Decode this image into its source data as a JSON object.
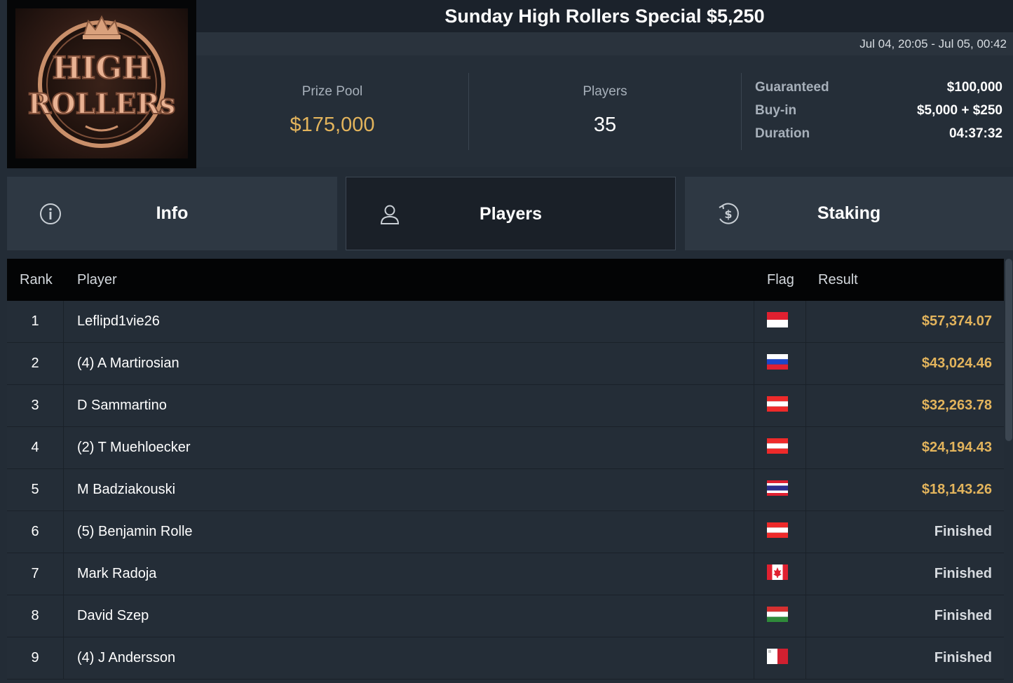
{
  "tournament": {
    "title": "Sunday High Rollers Special $5,250",
    "date_range": "Jul 04, 20:05 - Jul 05, 00:42",
    "logo_text": "HIGH ROLLERS"
  },
  "stats": {
    "prize_pool_label": "Prize Pool",
    "prize_pool_value": "$175,000",
    "players_label": "Players",
    "players_value": "35",
    "details": [
      {
        "label": "Guaranteed",
        "value": "$100,000"
      },
      {
        "label": "Buy-in",
        "value": "$5,000 + $250"
      },
      {
        "label": "Duration",
        "value": "04:37:32"
      }
    ]
  },
  "tabs": [
    {
      "label": "Info",
      "icon": "info-icon",
      "active": false
    },
    {
      "label": "Players",
      "icon": "user-icon",
      "active": true
    },
    {
      "label": "Staking",
      "icon": "dollar-coin-icon",
      "active": false
    }
  ],
  "table": {
    "headers": {
      "rank": "Rank",
      "player": "Player",
      "flag": "Flag",
      "result": "Result"
    },
    "rows": [
      {
        "rank": "1",
        "player": "Leflipd1vie26",
        "flag": "monaco",
        "result": "$57,374.07",
        "paid": true
      },
      {
        "rank": "2",
        "player": "(4) A Martirosian",
        "flag": "russia",
        "result": "$43,024.46",
        "paid": true
      },
      {
        "rank": "3",
        "player": "D Sammartino",
        "flag": "austria",
        "result": "$32,263.78",
        "paid": true
      },
      {
        "rank": "4",
        "player": "(2) T Muehloecker",
        "flag": "austria",
        "result": "$24,194.43",
        "paid": true
      },
      {
        "rank": "5",
        "player": "M Badziakouski",
        "flag": "thailand",
        "result": "$18,143.26",
        "paid": true
      },
      {
        "rank": "6",
        "player": "(5) Benjamin Rolle",
        "flag": "austria",
        "result": "Finished",
        "paid": false
      },
      {
        "rank": "7",
        "player": "Mark Radoja",
        "flag": "canada",
        "result": "Finished",
        "paid": false
      },
      {
        "rank": "8",
        "player": "David Szep",
        "flag": "hungary",
        "result": "Finished",
        "paid": false
      },
      {
        "rank": "9",
        "player": "(4) J Andersson",
        "flag": "malta",
        "result": "Finished",
        "paid": false
      }
    ]
  },
  "colors": {
    "accent_gold": "#e3b45c",
    "background": "#232c36",
    "header_black": "#030405"
  }
}
